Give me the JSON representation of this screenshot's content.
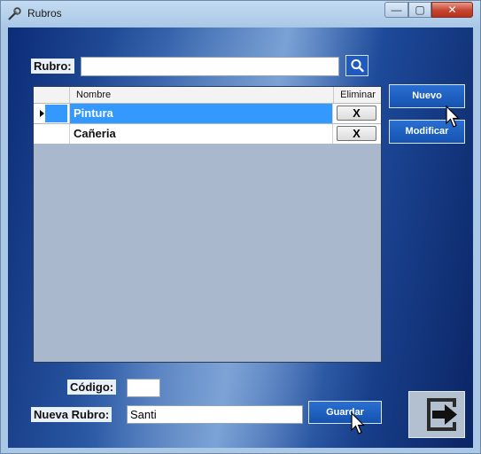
{
  "window": {
    "title": "Rubros",
    "icon": "tools-icon",
    "controls": {
      "minimize": "—",
      "maximize": "▢",
      "close": "✕"
    }
  },
  "search": {
    "label": "Rubro:",
    "value": "",
    "placeholder": "",
    "icon": "search-icon"
  },
  "grid": {
    "columns": [
      "Nombre",
      "Eliminar"
    ],
    "rows": [
      {
        "name": "Pintura",
        "delete": "X",
        "selected": true
      },
      {
        "name": "Cañeria",
        "delete": "X",
        "selected": false
      }
    ]
  },
  "buttons": {
    "nuevo": "Nuevo",
    "modificar": "Modificar",
    "guardar": "Guardar",
    "exit_icon": "exit-arrow-icon"
  },
  "form": {
    "codigo_label": "Código:",
    "codigo_value": "",
    "nombre_label": "Nueva Rubro:",
    "nombre_value": "Santi"
  },
  "colors": {
    "accent": "#1553b0",
    "selection": "#3399ff",
    "window_border": "#aac8e6"
  }
}
